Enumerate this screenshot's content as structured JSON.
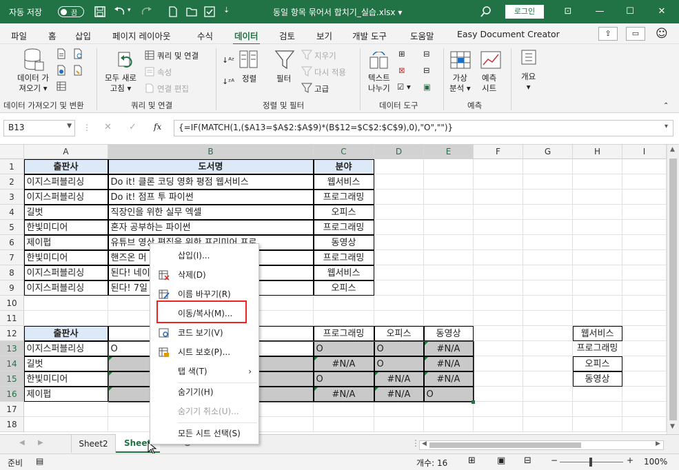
{
  "titlebar": {
    "autosave_label": "자동 저장",
    "autosave_state": "끔",
    "filename": "동일 항목 묶어서 합치기_실습.xlsx",
    "login": "로그인"
  },
  "menu": [
    "파일",
    "홈",
    "삽입",
    "페이지 레이아웃",
    "수식",
    "데이터",
    "검토",
    "보기",
    "개발 도구",
    "도움말",
    "Easy Document Creator"
  ],
  "active_menu": "데이터",
  "ribbon": {
    "get_data": [
      "데이터 가",
      "져오기"
    ],
    "refresh": [
      "모두 새로",
      "고침"
    ],
    "queries": "쿼리 및 연결",
    "properties": "속성",
    "edit_links": "연결 편집",
    "sort": "정렬",
    "filter": "필터",
    "clear": "지우기",
    "reapply": "다시 적용",
    "advanced": "고급",
    "text_to_columns": [
      "텍스트",
      "나누기"
    ],
    "what_if": [
      "가상",
      "분석"
    ],
    "forecast": [
      "예측",
      "시트"
    ],
    "outline": "개요",
    "groups": [
      "데이터 가져오기 및 변환",
      "쿼리 및 연결",
      "정렬 및 필터",
      "데이터 도구",
      "예측"
    ]
  },
  "formula_bar": {
    "name_box": "B13",
    "fx": "fx",
    "formula": "{=IF(MATCH(1,($A13=$A$2:$A$9)*(B$12=$C$2:$C$9),0),\"O\",\"\")}"
  },
  "columns": [
    "A",
    "B",
    "C",
    "D",
    "E",
    "F",
    "G",
    "H",
    "I"
  ],
  "rows": [
    "1",
    "2",
    "3",
    "4",
    "5",
    "6",
    "7",
    "8",
    "9",
    "10",
    "11",
    "12",
    "13",
    "14",
    "15",
    "16",
    "17",
    "18"
  ],
  "table1": {
    "headers": [
      "출판사",
      "도서명",
      "분야"
    ],
    "rows": [
      [
        "이지스퍼블리싱",
        "Do it! 클론 코딩 영화 평점 웹서비스",
        "웹서비스"
      ],
      [
        "이지스퍼블리싱",
        "Do it! 점프 투 파이썬",
        "프로그래밍"
      ],
      [
        "길벗",
        "직장인을 위한 실무 엑셀",
        "오피스"
      ],
      [
        "한빛미디어",
        "혼자 공부하는 파이썬",
        "프로그래밍"
      ],
      [
        "제이펍",
        "유튜브 영상 편집을 위한 프리미어 프로",
        "동영상"
      ],
      [
        "한빛미디어",
        "핸즈온 머",
        "프로그래밍"
      ],
      [
        "이지스퍼블리싱",
        "된다! 네이",
        "웹서비스"
      ],
      [
        "이지스퍼블리싱",
        "된다! 7일",
        "오피스"
      ]
    ]
  },
  "table2": {
    "header": "출판사",
    "categories": [
      "프로그래밍",
      "오피스",
      "동영상"
    ],
    "publishers": [
      "이지스퍼블리싱",
      "길벗",
      "한빛미디어",
      "제이펍"
    ],
    "b_values": [
      "O",
      "",
      "",
      ""
    ],
    "values": [
      [
        "O",
        "O",
        "#N/A"
      ],
      [
        "#N/A",
        "O",
        "#N/A"
      ],
      [
        "O",
        "#N/A",
        "#N/A"
      ],
      [
        "#N/A",
        "#N/A",
        "O"
      ]
    ]
  },
  "list_h": [
    "웹서비스",
    "프로그래밍",
    "오피스",
    "동영상"
  ],
  "context_menu": {
    "items": [
      "삽입(I)...",
      "삭제(D)",
      "이름 바꾸기(R)",
      "이동/복사(M)...",
      "코드 보기(V)",
      "시트 보호(P)...",
      "탭 색(T)",
      "숨기기(H)",
      "숨기기 취소(U)...",
      "모든 시트 선택(S)"
    ]
  },
  "sheets": [
    "Sheet2",
    "Sheet"
  ],
  "status": {
    "ready": "준비",
    "count": "개수: 16",
    "zoom": "100%"
  },
  "colors": {
    "accent": "#217346",
    "highlight": "#e22222",
    "header_fill": "#dde9f6"
  }
}
